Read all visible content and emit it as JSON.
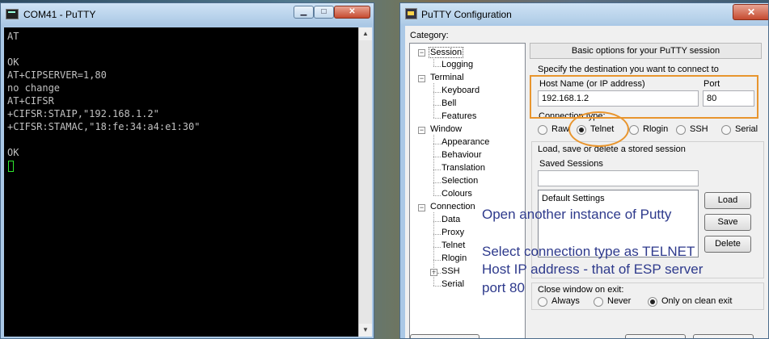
{
  "terminal": {
    "title": "COM41 - PuTTY",
    "lines": [
      "AT",
      "",
      "OK",
      "AT+CIPSERVER=1,80",
      "no change",
      "AT+CIFSR",
      "+CIFSR:STAIP,\"192.168.1.2\"",
      "+CIFSR:STAMAC,\"18:fe:34:a4:e1:30\"",
      "",
      "OK"
    ],
    "minimize": "▁",
    "maximize": "□",
    "close": "✕"
  },
  "config": {
    "title": "PuTTY Configuration",
    "close": "✕",
    "category_label": "Category:",
    "tree": [
      {
        "label": "Session",
        "top": true,
        "expanded": true
      },
      {
        "label": "Logging"
      },
      {
        "label": "Terminal",
        "top": true,
        "expanded": true
      },
      {
        "label": "Keyboard"
      },
      {
        "label": "Bell"
      },
      {
        "label": "Features"
      },
      {
        "label": "Window",
        "top": true,
        "expanded": true
      },
      {
        "label": "Appearance"
      },
      {
        "label": "Behaviour"
      },
      {
        "label": "Translation"
      },
      {
        "label": "Selection"
      },
      {
        "label": "Colours"
      },
      {
        "label": "Connection",
        "top": true,
        "expanded": true
      },
      {
        "label": "Data"
      },
      {
        "label": "Proxy"
      },
      {
        "label": "Telnet"
      },
      {
        "label": "Rlogin"
      },
      {
        "label": "SSH",
        "expandable": true
      },
      {
        "label": "Serial"
      }
    ],
    "panel_header": "Basic options for your PuTTY session",
    "destination_label": "Specify the destination you want to connect to",
    "host_label": "Host Name (or IP address)",
    "host_value": "192.168.1.2",
    "port_label": "Port",
    "port_value": "80",
    "conn_type_label": "Connection type:",
    "conn_types": [
      {
        "label": "Raw",
        "selected": false
      },
      {
        "label": "Telnet",
        "selected": true
      },
      {
        "label": "Rlogin",
        "selected": false
      },
      {
        "label": "SSH",
        "selected": false
      },
      {
        "label": "Serial",
        "selected": false
      }
    ],
    "load_save_label": "Load, save or delete a stored session",
    "saved_sessions_label": "Saved Sessions",
    "saved_sessions_value": "",
    "sessions": [
      "Default Settings"
    ],
    "load_button": "Load",
    "save_button": "Save",
    "delete_button": "Delete",
    "close_exit_label": "Close window on exit:",
    "close_options": [
      {
        "label": "Always",
        "selected": false
      },
      {
        "label": "Never",
        "selected": false
      },
      {
        "label": "Only on clean exit",
        "selected": true
      }
    ]
  },
  "annotations": {
    "line1": "Open another instance of Putty",
    "line2": "Select connection type as TELNET",
    "line3": "Host IP address - that of ESP server",
    "line4": "port 80",
    "highlight_color": "#e8952e",
    "text_color": "#2e3a8c"
  }
}
